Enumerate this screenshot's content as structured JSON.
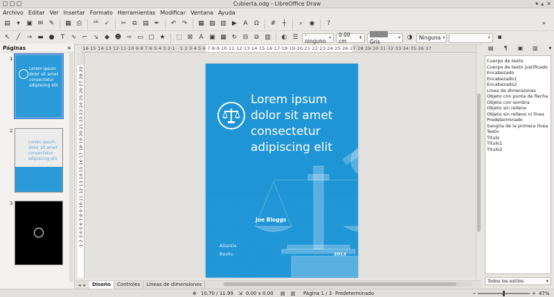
{
  "window": {
    "title": "Cubierta.odg - LibreOffice Draw"
  },
  "menu": [
    "Archivo",
    "Editar",
    "Ver",
    "Insertar",
    "Formato",
    "Herramientas",
    "Modificar",
    "Ventana",
    "Ayuda"
  ],
  "toolbar": {
    "line_style": "- ninguno",
    "line_width": "0.00 cm",
    "line_color": "Gris",
    "area_style": "Ninguna",
    "area_fill": ""
  },
  "slides_pane": {
    "title": "Páginas",
    "pages": [
      {
        "number": "1",
        "lines": [
          "Lorem ipsum",
          "dolor sit amet",
          "consectetur",
          "adipiscing elit"
        ]
      },
      {
        "number": "2",
        "lines": [
          "Lorem ipsum",
          "dolor sit amet",
          "consectetur",
          "adipiscing elit"
        ]
      },
      {
        "number": "3",
        "lines": []
      }
    ]
  },
  "rulers": {
    "horizontal": "·16·15·14·13·12·11·10·9·8·7·6·5·4·3·2·1·  ·1·2·3·4·5·6·7·8·9·10·11·12·13·14·15·16·17·18·19·20·21·22·23·24·25·26·27·28·29·30·31·32·33·34·35·36·37",
    "vertical": "·1·2·3·4·5·6·7·8·9·10·11·12·13·14·15·16·17·18·19·20·21·22·23·24·25·26·27·28·29"
  },
  "page": {
    "title_lines": [
      "Lorem ipsum",
      "dolor sit amet",
      "consectetur",
      "adipiscing elit"
    ],
    "author": "Joe Bloggs",
    "publisher_line1": "Atlantis",
    "publisher_line2": "Books",
    "year": "2013",
    "background_color": "#1f95d6"
  },
  "tabs": {
    "items": [
      "Diseño",
      "Controles",
      "Líneas de dimensiones"
    ],
    "active": "Diseño"
  },
  "styles": {
    "items": [
      "Cuerpo de texto",
      "Cuerpo de texto justificado",
      "Encabezado",
      "Encabezado1",
      "Encabezado2",
      "Línea de dimensiones",
      "Objeto con punta de flecha",
      "Objeto con sombra",
      "Objeto sin relleno",
      "Objeto sin relleno ni línea",
      "Predeterminado",
      "Sangría de la primera línea",
      "Texto",
      "Título",
      "Título1",
      "Título2"
    ],
    "filter": "Todos los estilos"
  },
  "statusbar": {
    "position": "10.70 / 11.99",
    "size": "0.00 x 0.00",
    "page": "Página 1 / 3",
    "layout": "Predeterminado",
    "zoom": "47%"
  },
  "colors": {
    "accent": "#1f95d6",
    "selection": "#3b78c4"
  }
}
